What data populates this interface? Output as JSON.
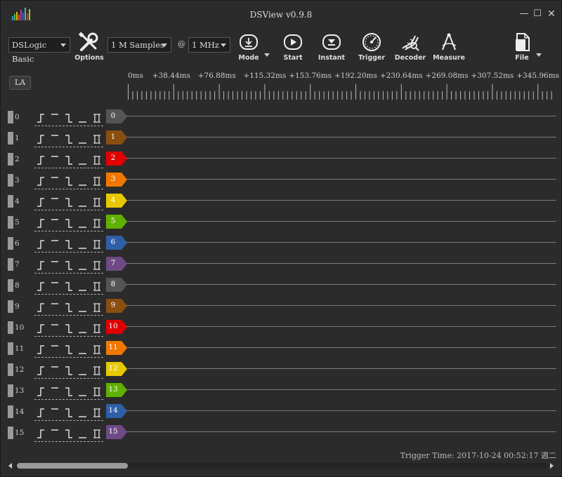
{
  "window": {
    "title": "DSView v0.9.8",
    "minimize_glyph": "—",
    "maximize_glyph": "☐",
    "close_glyph": "✕"
  },
  "toolbar": {
    "device": "DSLogic Basic",
    "samples": "1 M Samples",
    "at": "@",
    "rate": "1 MHz",
    "options_label": "Options",
    "mode_label": "Mode",
    "start_label": "Start",
    "instant_label": "Instant",
    "trigger_label": "Trigger",
    "decoder_label": "Decoder",
    "measure_label": "Measure",
    "file_label": "File"
  },
  "la_label": "LA",
  "ruler": {
    "labels": [
      "0ms",
      "+38.44ms",
      "+76.88ms",
      "+115.32ms",
      "+153.76ms",
      "+192.20ms",
      "+230.64ms",
      "+269.08ms",
      "+307.52ms",
      "+345.96ms"
    ]
  },
  "channels": [
    {
      "id": "0",
      "color": "#555555"
    },
    {
      "id": "1",
      "color": "#8a4f10"
    },
    {
      "id": "2",
      "color": "#e00000"
    },
    {
      "id": "3",
      "color": "#f07800"
    },
    {
      "id": "4",
      "color": "#e8c800"
    },
    {
      "id": "5",
      "color": "#5fb000"
    },
    {
      "id": "6",
      "color": "#2f5fa8"
    },
    {
      "id": "7",
      "color": "#6f4a86"
    },
    {
      "id": "8",
      "color": "#555555"
    },
    {
      "id": "9",
      "color": "#8a4f10"
    },
    {
      "id": "10",
      "color": "#e00000"
    },
    {
      "id": "11",
      "color": "#f07800"
    },
    {
      "id": "12",
      "color": "#e8c800"
    },
    {
      "id": "13",
      "color": "#5fb000"
    },
    {
      "id": "14",
      "color": "#2f5fa8"
    },
    {
      "id": "15",
      "color": "#6f4a86"
    }
  ],
  "trigger_time": "Trigger Time: 2017-10-24 00:52:17 週二",
  "icons": {
    "logo": "dsview-logo-icon",
    "options": "wrench-icon",
    "mode": "download-circle-icon",
    "start": "play-icon",
    "instant": "single-shot-icon",
    "trigger": "speedometer-icon",
    "decoder": "dna-icon",
    "measure": "compass-icon",
    "file": "document-icon"
  }
}
